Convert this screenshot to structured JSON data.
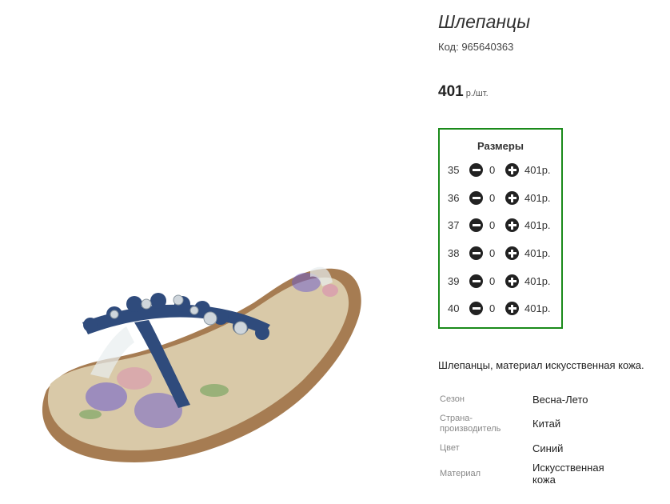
{
  "product": {
    "title": "Шлепанцы",
    "code": "Код: 965640363",
    "price_amount": "401",
    "price_unit": "р./шт.",
    "description": "Шлепанцы, материал искусственная кожа."
  },
  "sizes": {
    "title": "Размеры",
    "rows": [
      {
        "size": "35",
        "qty": "0",
        "price": "401р."
      },
      {
        "size": "36",
        "qty": "0",
        "price": "401р."
      },
      {
        "size": "37",
        "qty": "0",
        "price": "401р."
      },
      {
        "size": "38",
        "qty": "0",
        "price": "401р."
      },
      {
        "size": "39",
        "qty": "0",
        "price": "401р."
      },
      {
        "size": "40",
        "qty": "0",
        "price": "401р."
      }
    ]
  },
  "properties": [
    {
      "label": "Сезон",
      "value": "Весна-Лето"
    },
    {
      "label": "Страна-\nпроизводитель",
      "value": "Китай"
    },
    {
      "label": "Цвет",
      "value": "Синий"
    },
    {
      "label": "Материал",
      "value": "Искусственная\nкожа"
    }
  ],
  "colors": {
    "accent_border": "#1a8a1a",
    "strap": "#2f4b7c",
    "insole": "#d9c9a8"
  },
  "icons": {
    "minus": "minus-circle-icon",
    "plus": "plus-circle-icon"
  }
}
